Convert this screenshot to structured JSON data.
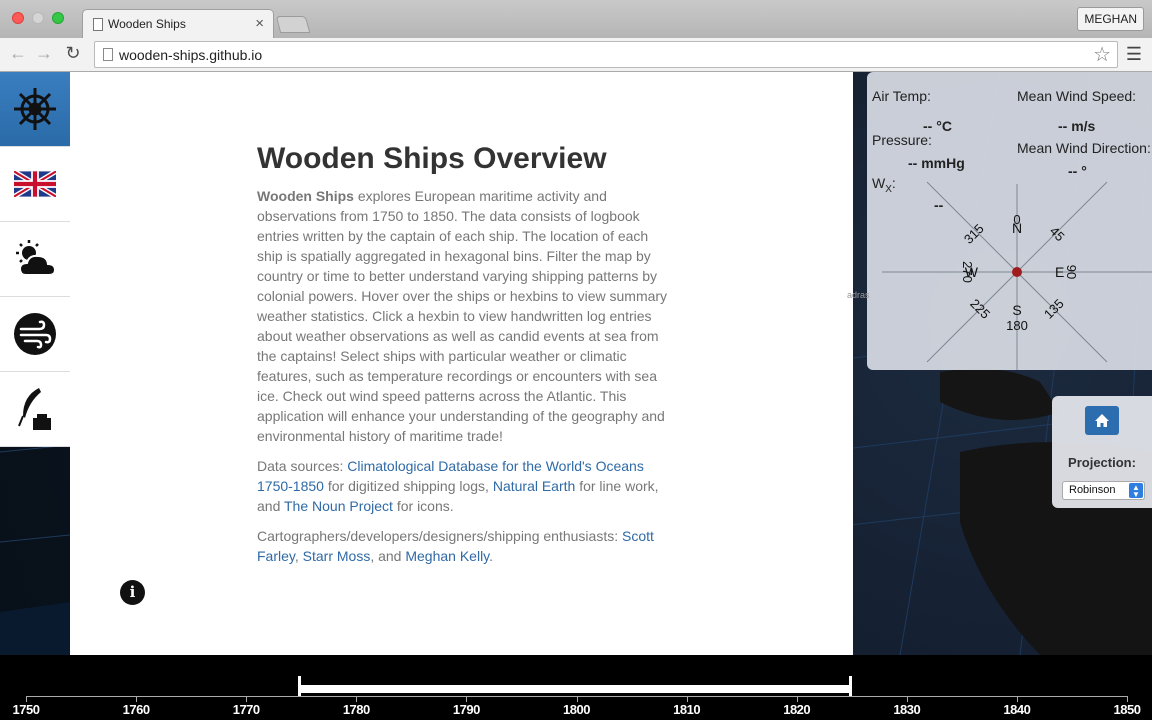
{
  "browser": {
    "tab_title": "Wooden Ships",
    "tab_close": "×",
    "url": "wooden-ships.github.io",
    "profile_name": "MEGHAN",
    "icons": [
      "back-arrow-icon",
      "forward-arrow-icon",
      "reload-icon",
      "bookmark-star-icon",
      "menu-icon"
    ]
  },
  "sidebar": {
    "items": [
      {
        "name": "ship-wheel",
        "active": true
      },
      {
        "name": "uk-flag",
        "active": false
      },
      {
        "name": "weather",
        "active": false
      },
      {
        "name": "wind",
        "active": false
      },
      {
        "name": "quill",
        "active": false
      }
    ]
  },
  "overview": {
    "title": "Wooden Ships Overview",
    "intro_bold": "Wooden Ships",
    "intro": " explores European maritime activity and observations from 1750 to 1850. The data consists of logbook entries written by the captain of each ship. The location of each ship is spatially aggregated in hexagonal bins. Filter the map by country or time to better understand varying shipping patterns by colonial powers. Hover over the ships or hexbins to view summary weather statistics. Click a hexbin to view handwritten log entries about weather observations as well as candid events at sea from the captains! Select ships with particular weather or climatic features, such as temperature recordings or encounters with sea ice. Check out wind speed patterns across the Atlantic. This application will enhance your understanding of the geography and environmental history of maritime trade!",
    "sources_prefix": "Data sources: ",
    "sources_link1": "Climatological Database for the World's Oceans 1750-1850",
    "sources_mid1": " for digitized shipping logs, ",
    "sources_link2": "Natural Earth",
    "sources_mid2": " for line work, and ",
    "sources_link3": "The Noun Project",
    "sources_suffix": " for icons.",
    "credits_prefix": "Cartographers/developers/designers/shipping enthusiasts: ",
    "credit1": "Scott Farley",
    "credit_sep": ", ",
    "credit2": "Starr Moss",
    "credit_and": ", and ",
    "credit3": "Meghan Kelly",
    "credit_end": ".",
    "info_icon": "i"
  },
  "weather": {
    "air_temp_label": "Air Temp:",
    "air_temp_value": "-- °C",
    "pressure_label": "Pressure:",
    "pressure_value": "-- mmHg",
    "wx_label": "W",
    "wx_sub": "X",
    "wx_colon": ":",
    "wx_value": "--",
    "wind_speed_label": "Mean Wind Speed:",
    "wind_speed_value": "-- m/s",
    "wind_dir_label": "Mean Wind Direction:",
    "wind_dir_value": "-- °",
    "compass": {
      "n": "N",
      "n_deg": "0",
      "e": "E",
      "e_deg": "90",
      "s": "S",
      "s_deg": "180",
      "w": "W",
      "w_deg": "270",
      "ne": "45",
      "se": "135",
      "sw": "225",
      "nw": "315"
    },
    "map_label": "adras"
  },
  "projection": {
    "label": "Projection:",
    "selected": "Robinson",
    "home_icon": "home-icon"
  },
  "timeline": {
    "years": [
      "1750",
      "1760",
      "1770",
      "1780",
      "1790",
      "1800",
      "1810",
      "1820",
      "1830",
      "1840",
      "1850"
    ],
    "brush_start": 1775,
    "brush_end": 1825
  },
  "colors": {
    "accent": "#2c6db0",
    "link": "#2f6aa6",
    "compass_center": "#a11d1d"
  }
}
